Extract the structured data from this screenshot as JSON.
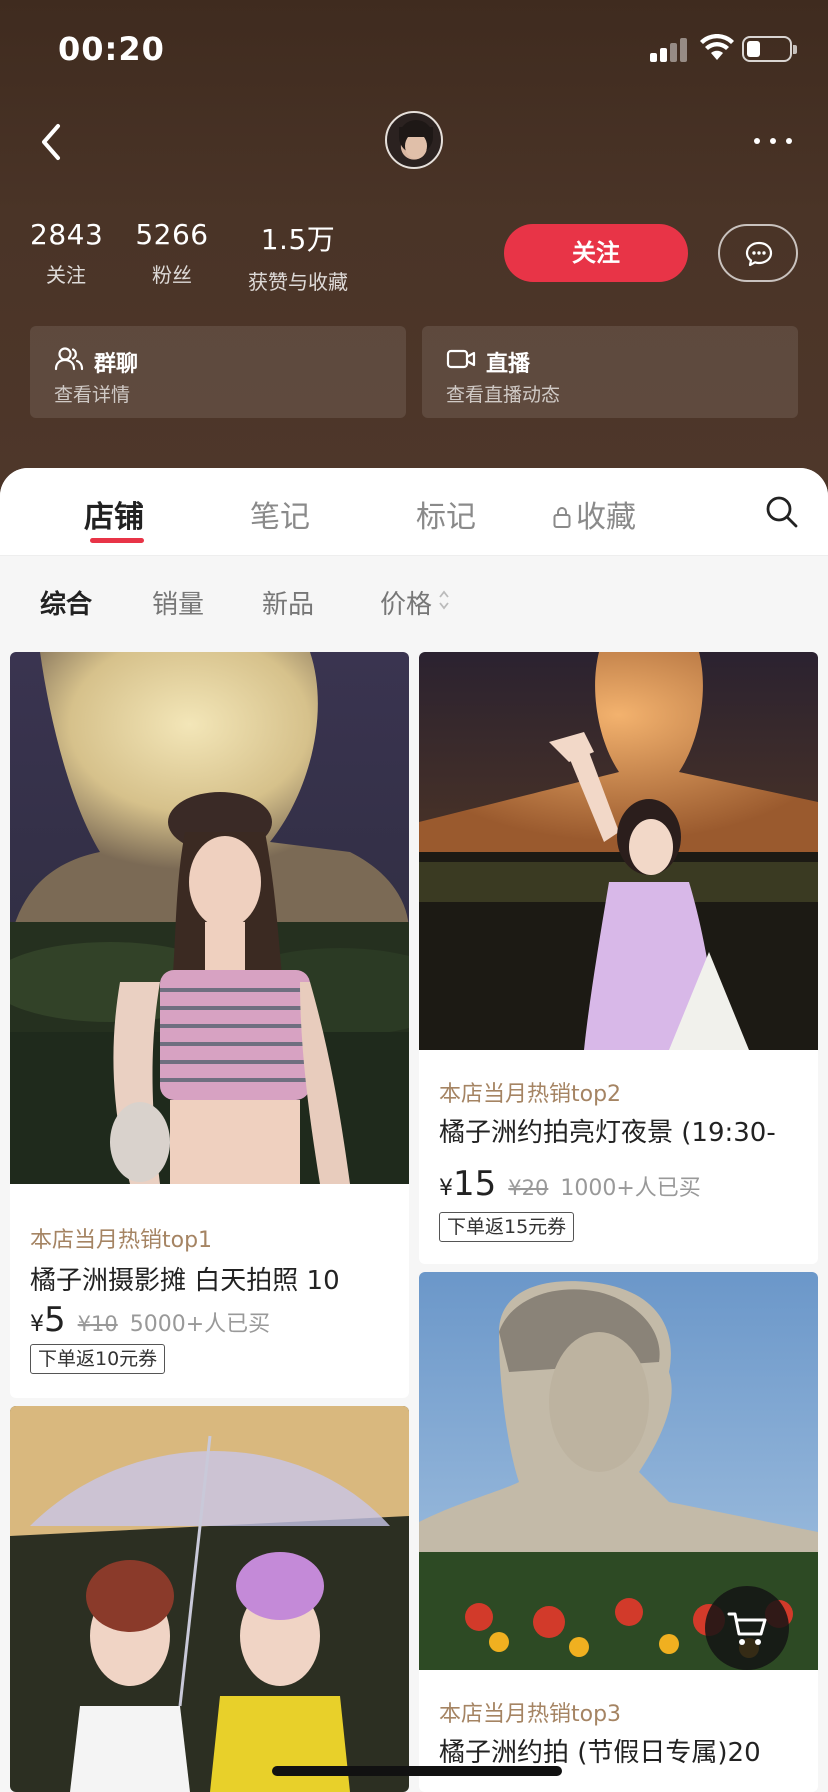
{
  "status_bar": {
    "time": "00:20"
  },
  "profile": {
    "stats": [
      {
        "num": "2843",
        "label": "关注"
      },
      {
        "num": "5266",
        "label": "粉丝"
      },
      {
        "num": "1.5万",
        "label": "获赞与收藏"
      }
    ],
    "follow_label": "关注",
    "cards": [
      {
        "title": "群聊",
        "subtitle": "查看详情"
      },
      {
        "title": "直播",
        "subtitle": "查看直播动态"
      }
    ]
  },
  "tabs": [
    "店铺",
    "笔记",
    "标记",
    "收藏"
  ],
  "active_tab": "店铺",
  "filters": [
    "综合",
    "销量",
    "新品",
    "价格"
  ],
  "active_filter": "综合",
  "products": [
    {
      "tag": "本店当月热销top1",
      "name": "橘子洲摄影摊 白天拍照 10",
      "yen": "¥",
      "price": "5",
      "original_price": "¥10",
      "sold": "5000+人已买",
      "coupon": "下单返10元券"
    },
    {
      "tag": "本店当月热销top2",
      "name": "橘子洲约拍亮灯夜景 (19:30-",
      "yen": "¥",
      "price": "15",
      "original_price": "¥20",
      "sold": "1000+人已买",
      "coupon": "下单返15元券"
    },
    {
      "tag": "本店当月热销top3",
      "name": "橘子洲约拍 (节假日专属)20"
    }
  ],
  "colors": {
    "accent": "#e83447",
    "header_bg": "#4a3427",
    "tag": "#a58463"
  },
  "icons": [
    "back-icon",
    "avatar",
    "more-icon",
    "chat-icon",
    "group-icon",
    "live-icon",
    "lock-icon",
    "search-icon",
    "sort-icon",
    "cart-icon"
  ]
}
